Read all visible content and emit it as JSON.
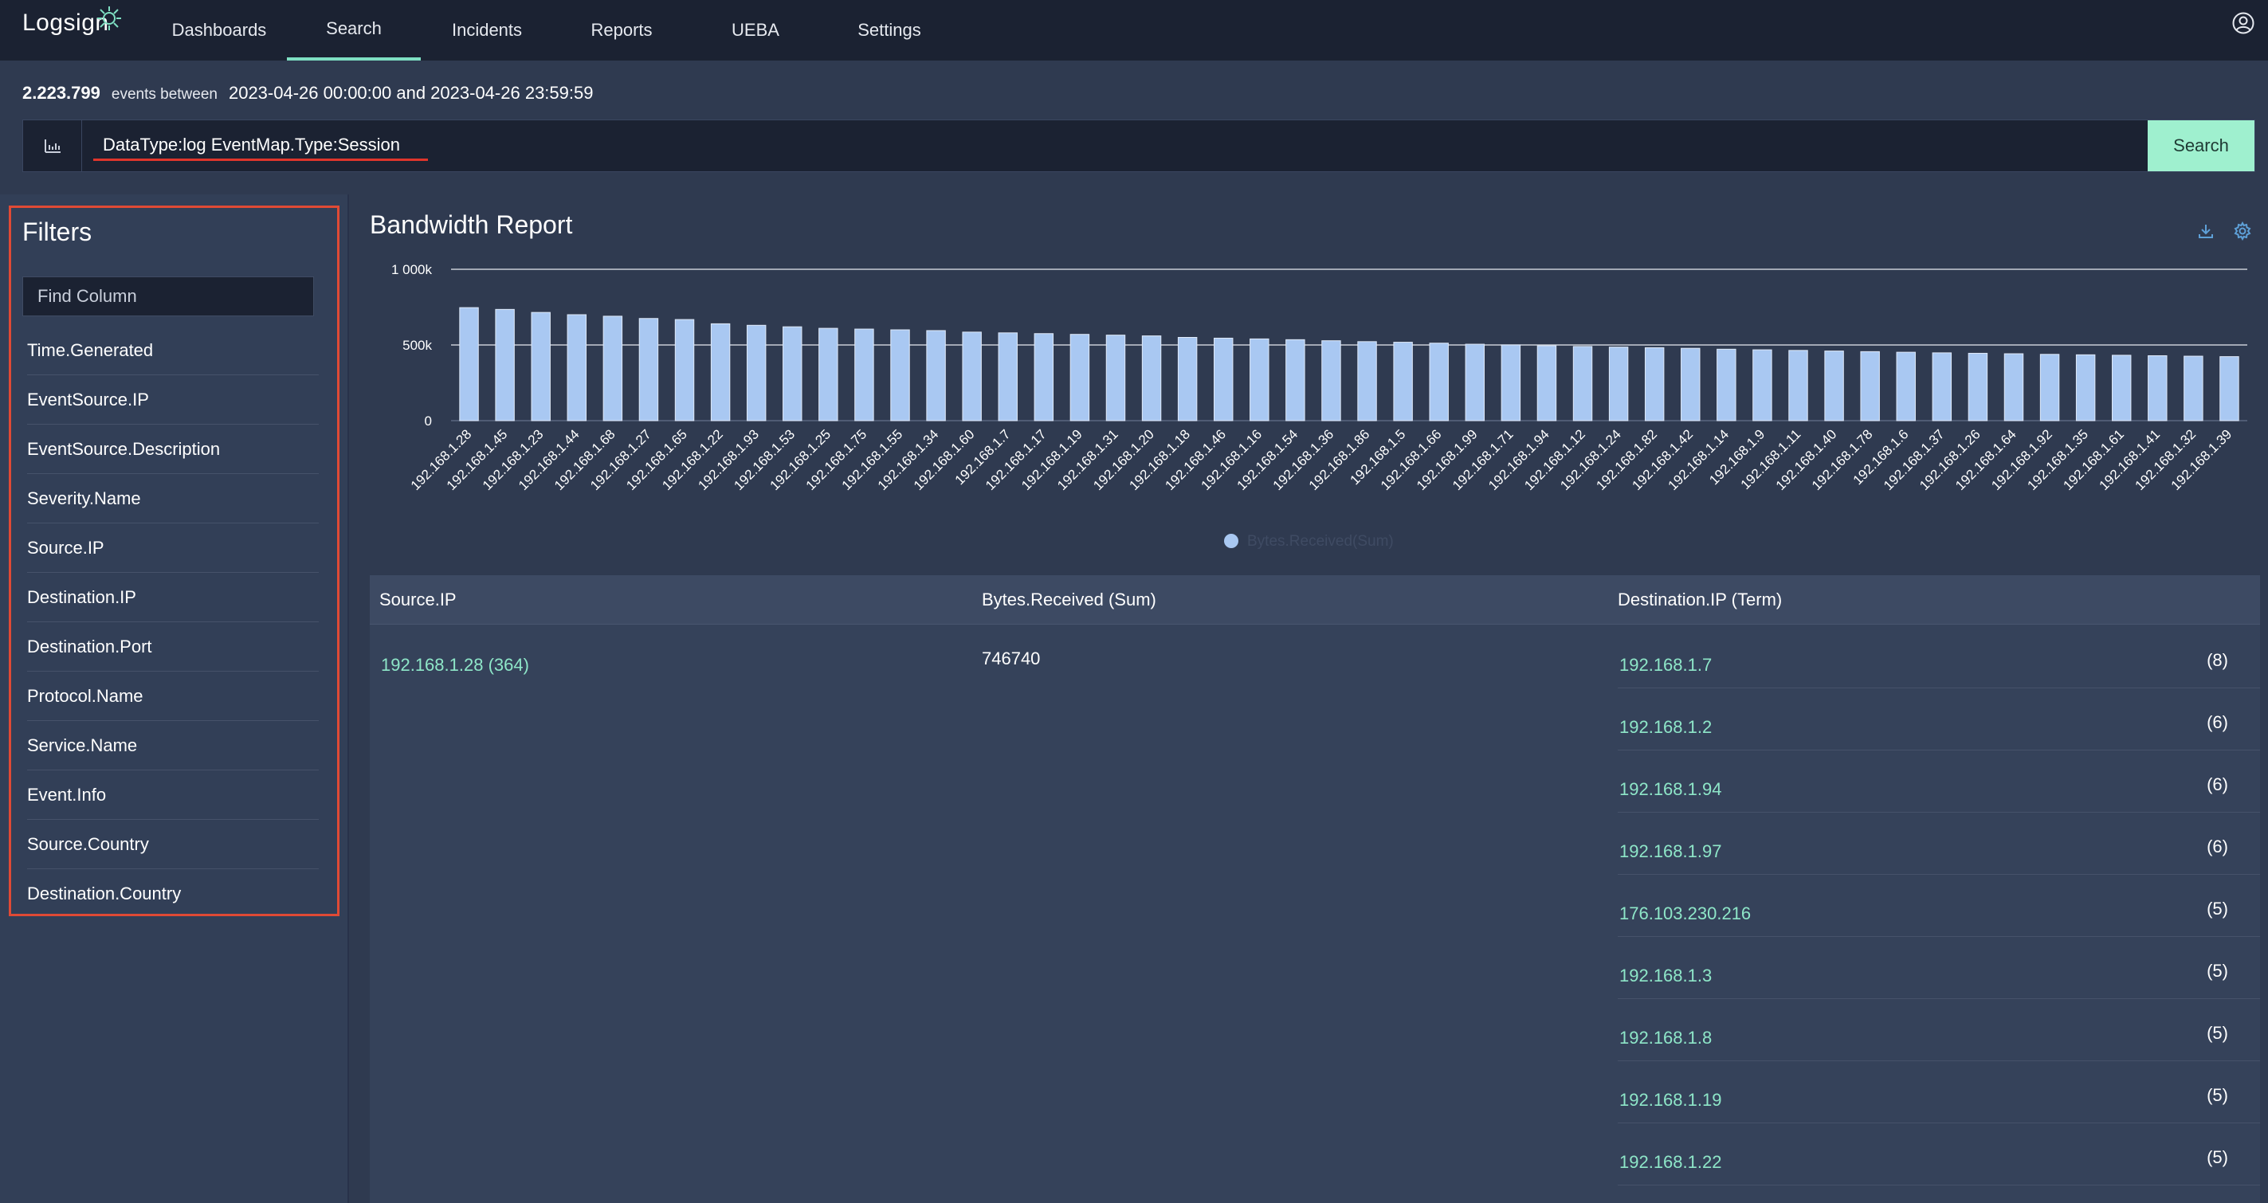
{
  "app": {
    "logo_text": "Logsign"
  },
  "nav": {
    "items": [
      {
        "label": "Dashboards"
      },
      {
        "label": "Search",
        "active": true
      },
      {
        "label": "Incidents"
      },
      {
        "label": "Reports"
      },
      {
        "label": "UEBA"
      },
      {
        "label": "Settings"
      }
    ],
    "user_icon": "user-circle-icon"
  },
  "summary": {
    "count": "2.223.799",
    "events_between": "events between",
    "range": "2023-04-26 00:00:00 and 2023-04-26 23:59:59"
  },
  "search": {
    "query": "DataType:log EventMap.Type:Session",
    "button_label": "Search",
    "chart_toggle_icon": "bar-chart-icon"
  },
  "filters": {
    "title": "Filters",
    "find_placeholder": "Find Column",
    "items": [
      "Time.Generated",
      "EventSource.IP",
      "EventSource.Description",
      "Severity.Name",
      "Source.IP",
      "Destination.IP",
      "Destination.Port",
      "Protocol.Name",
      "Service.Name",
      "Event.Info",
      "Source.Country",
      "Destination.Country"
    ]
  },
  "report": {
    "title": "Bandwidth Report",
    "icons": [
      "download-icon",
      "settings-icon"
    ]
  },
  "chart_data": {
    "type": "bar",
    "categories": [
      "192.168.1.28",
      "192.168.1.45",
      "192.168.1.23",
      "192.168.1.44",
      "192.168.1.68",
      "192.168.1.27",
      "192.168.1.65",
      "192.168.1.22",
      "192.168.1.93",
      "192.168.1.53",
      "192.168.1.25",
      "192.168.1.75",
      "192.168.1.55",
      "192.168.1.34",
      "192.168.1.60",
      "192.168.1.7",
      "192.168.1.17",
      "192.168.1.19",
      "192.168.1.31",
      "192.168.1.20",
      "192.168.1.18",
      "192.168.1.46",
      "192.168.1.16",
      "192.168.1.54",
      "192.168.1.36",
      "192.168.1.86",
      "192.168.1.5",
      "192.168.1.66",
      "192.168.1.99",
      "192.168.1.71",
      "192.168.1.94",
      "192.168.1.12",
      "192.168.1.24",
      "192.168.1.82",
      "192.168.1.42",
      "192.168.1.14",
      "192.168.1.9",
      "192.168.1.11",
      "192.168.1.40",
      "192.168.1.78",
      "192.168.1.6",
      "192.168.1.37",
      "192.168.1.26",
      "192.168.1.64",
      "192.168.1.92",
      "192.168.1.35",
      "192.168.1.61",
      "192.168.1.41",
      "192.168.1.32",
      "192.168.1.39"
    ],
    "series": [
      {
        "name": "Bytes.Received(Sum)",
        "color": "#a9c8f2",
        "values": [
          746740,
          735000,
          715000,
          700000,
          690000,
          675000,
          668000,
          640000,
          630000,
          620000,
          610000,
          605000,
          600000,
          595000,
          585000,
          580000,
          575000,
          570000,
          565000,
          560000,
          550000,
          545000,
          540000,
          535000,
          528000,
          522000,
          518000,
          512000,
          505000,
          500000,
          495000,
          490000,
          486000,
          482000,
          478000,
          472000,
          468000,
          464000,
          460000,
          456000,
          452000,
          448000,
          445000,
          442000,
          438000,
          435000,
          432000,
          429000,
          426000,
          423000
        ]
      }
    ],
    "yticks": [
      "1 000k",
      "500k",
      "0"
    ],
    "ylim": [
      0,
      1000000
    ],
    "legend": "bottom-center"
  },
  "table": {
    "headers": [
      "Source.IP",
      "Bytes.Received (Sum)",
      "Destination.IP (Term)"
    ],
    "source_ip": "192.168.1.28 (364)",
    "bytes": "746740",
    "destinations": [
      {
        "ip": "192.168.1.7",
        "count": "(8)"
      },
      {
        "ip": "192.168.1.2",
        "count": "(6)"
      },
      {
        "ip": "192.168.1.94",
        "count": "(6)"
      },
      {
        "ip": "192.168.1.97",
        "count": "(6)"
      },
      {
        "ip": "176.103.230.216",
        "count": "(5)"
      },
      {
        "ip": "192.168.1.3",
        "count": "(5)"
      },
      {
        "ip": "192.168.1.8",
        "count": "(5)"
      },
      {
        "ip": "192.168.1.19",
        "count": "(5)"
      },
      {
        "ip": "192.168.1.22",
        "count": "(5)"
      }
    ]
  }
}
